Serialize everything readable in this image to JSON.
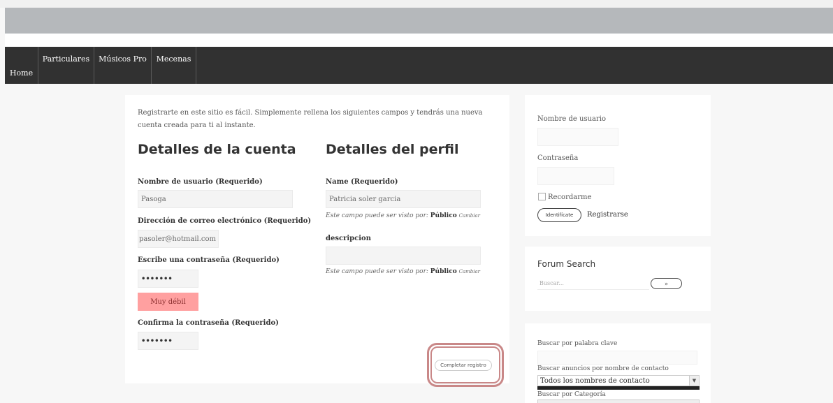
{
  "nav": {
    "home": "Home",
    "particulares": "Particulares",
    "musicos_pro": "Músicos Pro",
    "mecenas": "Mecenas"
  },
  "register": {
    "intro": "Registrarte en este sitio es fácil. Simplemente rellena los siguientes campos y tendrás una nueva cuenta creada para ti al instante.",
    "account_heading": "Detalles de la cuenta",
    "profile_heading": "Detalles del perfil",
    "username_label": "Nombre de usuario (Requerido)",
    "username_value": "Pasoga",
    "email_label": "Dirección de correo electrónico (Requerido)",
    "email_value": "pasoler@hotmail.com",
    "password_label": "Escribe una contraseña (Requerido)",
    "password_value": "•••••••",
    "strength": "Muy débil",
    "confirm_label": "Confirma la contraseña (Requerido)",
    "confirm_value": "•••••••",
    "name_label": "Name (Requerido)",
    "name_value": "Patricia soler garcia",
    "visibility_prefix": "Este campo puede ser visto por:",
    "visibility_value": "Público",
    "visibility_change": "Cambiar",
    "description_label": "descripcion",
    "description_value": "",
    "submit": "Completar registro"
  },
  "login": {
    "username_label": "Nombre de usuario",
    "password_label": "Contraseña",
    "remember": "Recordarme",
    "login_button": "Identifícate",
    "register_link": "Registrarse"
  },
  "forum": {
    "title": "Forum Search",
    "placeholder": "Buscar...",
    "button": "»"
  },
  "ads": {
    "keyword_label": "Buscar por palabra clave",
    "contact_label": "Buscar anuncios por nombre de contacto",
    "contact_selected": "Todos los nombres de contacto",
    "category_label": "Buscar por Categoría"
  },
  "colors": {
    "nav_bg": "#313131",
    "strength_bg": "#ffa0a0",
    "highlight": "#c98888"
  }
}
